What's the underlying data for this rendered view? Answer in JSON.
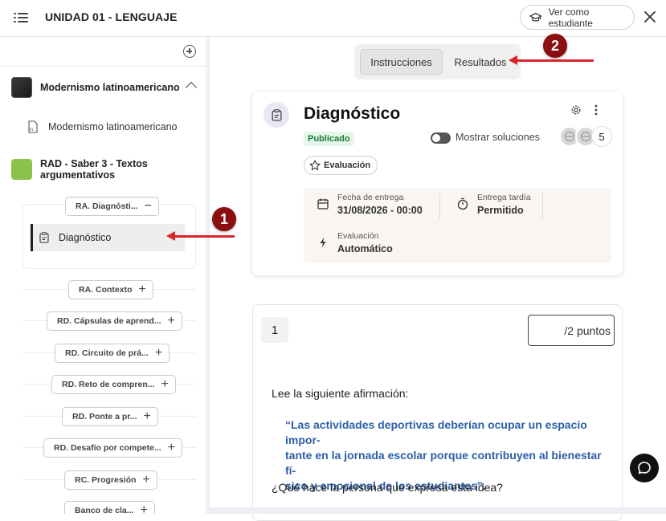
{
  "header": {
    "title": "UNIDAD 01 - LENGUAJE",
    "student_view_label": "Ver como estudiante"
  },
  "sidebar": {
    "modules": [
      {
        "label": "Modernismo latinoamericano",
        "thumb_color": "#2a2a2a",
        "expanded": true
      },
      {
        "label": "RAD - Saber 3 - Textos argumentativos",
        "thumb_color": "#8bc34a"
      }
    ],
    "sub_items": [
      {
        "label": "Modernismo latinoamericano",
        "icon": "file-text-icon"
      }
    ],
    "groups": [
      {
        "label": "RA. Diagnósti...",
        "sign": "−"
      },
      {
        "label": "RA. Contexto",
        "sign": "+"
      },
      {
        "label": "RD. Cápsulas de aprend...",
        "sign": "+"
      },
      {
        "label": "RD. Circuito de prá...",
        "sign": "+"
      },
      {
        "label": "RD. Reto de compren...",
        "sign": "+"
      },
      {
        "label": "RD. Ponte a pr...",
        "sign": "+"
      },
      {
        "label": "RD. Desafío por compete...",
        "sign": "+"
      },
      {
        "label": "RC. Progresión",
        "sign": "+"
      },
      {
        "label": "Banco de cla...",
        "sign": "+"
      }
    ],
    "active_item": {
      "label": "Diagnóstico",
      "icon": "clipboard-icon"
    }
  },
  "tabs": [
    {
      "label": "Instrucciones",
      "active": true
    },
    {
      "label": "Resultados",
      "active": false
    }
  ],
  "assignment": {
    "title": "Diagnóstico",
    "status": "Publicado",
    "show_solutions_label": "Mostrar soluciones",
    "show_solutions_on": false,
    "student_count": "5",
    "type_label": "Evaluación",
    "due_label": "Fecha de entrega",
    "due_value": "31/08/2026 - 00:00",
    "late_label": "Entrega tardía",
    "late_value": "Permitido",
    "eval_label": "Evaluación",
    "eval_value": "Automático"
  },
  "question": {
    "number": "1",
    "points": "/2 puntos",
    "intro": "Lee la siguiente afirmación:",
    "quote_lines": [
      "“Las actividades deportivas deberían ocupar un espacio impor-",
      "tante en la jornada escolar porque contribuyen al bienestar fí-",
      "sico y emocional de los estudiantes”."
    ],
    "prompt": "¿Qué hace la persona que expresa esta idea?"
  },
  "annotations": [
    {
      "number": "1",
      "color": "#8b0e10"
    },
    {
      "number": "2",
      "color": "#8b0e10"
    }
  ],
  "colors": {
    "accent_red": "#d8262b",
    "quote_blue": "#2c5fa8",
    "published_green": "#1a7a3a"
  }
}
